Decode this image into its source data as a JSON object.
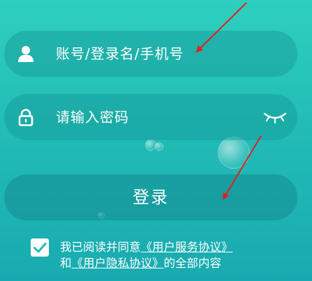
{
  "login_form": {
    "account_placeholder": "账号/登录名/手机号",
    "password_placeholder": "请输入密码",
    "login_label": "登录"
  },
  "agreement": {
    "checked": true,
    "prefix": "我已阅读并同意",
    "user_agreement_link": "《用户服务协议》",
    "and_text": "和",
    "privacy_link": "《用户隐私协议》",
    "suffix": "的全部内容"
  },
  "icons": {
    "user": "user-icon",
    "lock": "lock-icon",
    "eye": "eye-closed-icon",
    "check": "check-icon"
  },
  "colors": {
    "background_top": "#2fcfbf",
    "background_bottom": "#18aab0",
    "annotation_arrow": "#e02020"
  }
}
